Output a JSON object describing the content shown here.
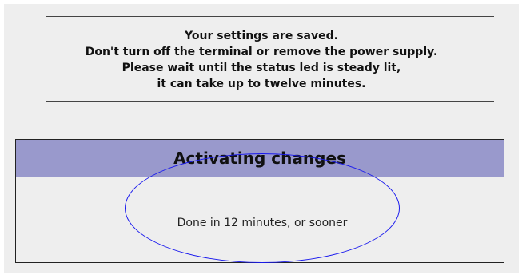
{
  "notice": {
    "lines": [
      "Your settings are saved.",
      "Don't turn off the terminal or remove the power supply.",
      "Please wait until the status led is steady lit,",
      "it can take up to twelve minutes."
    ]
  },
  "activation": {
    "title": "Activating changes",
    "status": "Done in 12 minutes, or sooner"
  },
  "colors": {
    "header_bg": "#9999cc",
    "panel_bg": "#eeeeee",
    "highlight_oval": "#1a1aee"
  }
}
